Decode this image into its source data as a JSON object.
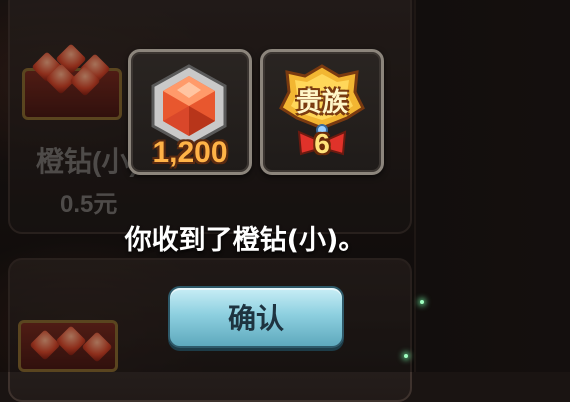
{
  "background": {
    "item_name": "橙钻(小)",
    "item_price": "0.5元"
  },
  "rewards": [
    {
      "icon": "orange-diamond-icon",
      "count": "1,200"
    },
    {
      "icon": "noble-badge-icon",
      "badge_text": "贵族",
      "level": "6"
    }
  ],
  "message": "你收到了橙钻(小)。",
  "confirm_label": "确认",
  "colors": {
    "count_text": "#ffb347",
    "button_top": "#c9eef6",
    "button_bottom": "#5ea9bd"
  }
}
